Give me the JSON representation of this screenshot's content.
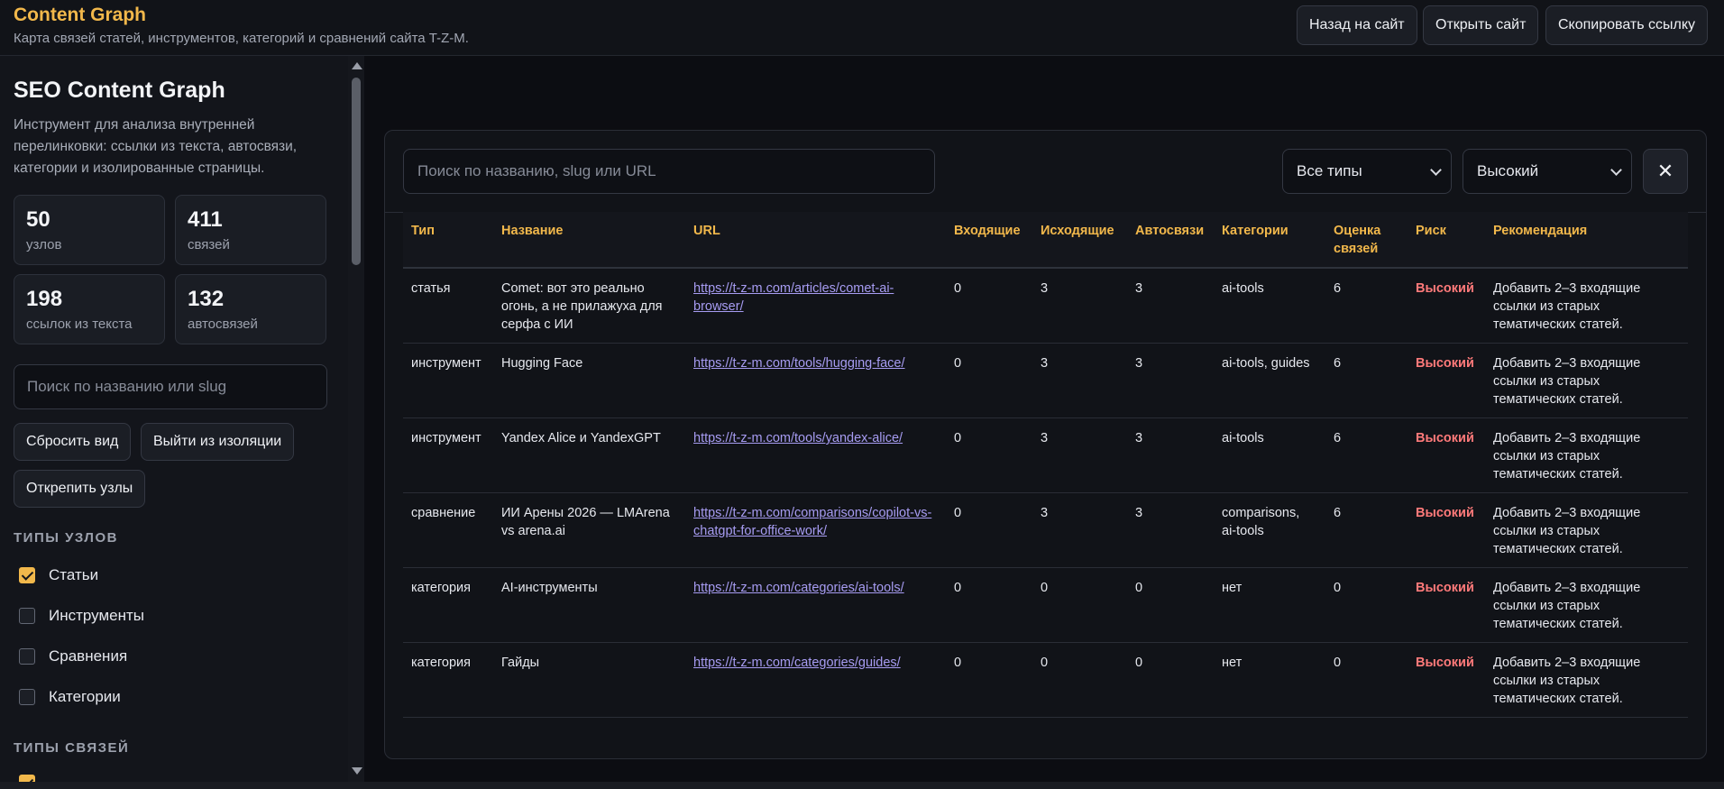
{
  "header": {
    "title": "Content Graph",
    "subtitle": "Карта связей статей, инструментов, категорий и сравнений сайта T-Z-M.",
    "buttons": {
      "back": "Назад на сайт",
      "open": "Открыть сайт",
      "copy": "Скопировать ссылку"
    }
  },
  "sidebar": {
    "title": "SEO Content Graph",
    "description": "Инструмент для анализа внутренней перелинковки: ссылки из текста, автосвязи, категории и изолированные страницы.",
    "stats": [
      {
        "value": "50",
        "label": "узлов"
      },
      {
        "value": "411",
        "label": "связей"
      },
      {
        "value": "198",
        "label": "ссылок из текста"
      },
      {
        "value": "132",
        "label": "автосвязей"
      }
    ],
    "search_placeholder": "Поиск по названию или slug",
    "buttons": {
      "reset": "Сбросить вид",
      "exit_isolation": "Выйти из изоляции",
      "unpin": "Открепить узлы"
    },
    "node_types_heading": "ТИПЫ УЗЛОВ",
    "node_types": [
      {
        "label": "Статьи",
        "checked": true
      },
      {
        "label": "Инструменты",
        "checked": false
      },
      {
        "label": "Сравнения",
        "checked": false
      },
      {
        "label": "Категории",
        "checked": false
      }
    ],
    "link_types_heading": "ТИПЫ СВЯЗЕЙ"
  },
  "filters": {
    "search_placeholder": "Поиск по названию, slug или URL",
    "type_value": "Все типы",
    "risk_value": "Высокий",
    "close_icon": "✕"
  },
  "table": {
    "headers": [
      "Тип",
      "Название",
      "URL",
      "Входящие",
      "Исходящие",
      "Автосвязи",
      "Категории",
      "Оценка связей",
      "Риск",
      "Рекомендация"
    ],
    "rows": [
      {
        "type": "статья",
        "name": "Comet: вот это реально огонь, а не прилажуха для серфа с ИИ",
        "url": "https://t-z-m.com/articles/comet-ai-browser/",
        "incoming": "0",
        "outgoing": "3",
        "auto": "3",
        "categories": "ai-tools",
        "score": "6",
        "risk": "Высокий",
        "recommendation": "Добавить 2–3 входящие ссылки из старых тематических статей."
      },
      {
        "type": "инструмент",
        "name": "Hugging Face",
        "url": "https://t-z-m.com/tools/hugging-face/",
        "incoming": "0",
        "outgoing": "3",
        "auto": "3",
        "categories": "ai-tools, guides",
        "score": "6",
        "risk": "Высокий",
        "recommendation": "Добавить 2–3 входящие ссылки из старых тематических статей."
      },
      {
        "type": "инструмент",
        "name": "Yandex Alice и YandexGPT",
        "url": "https://t-z-m.com/tools/yandex-alice/",
        "incoming": "0",
        "outgoing": "3",
        "auto": "3",
        "categories": "ai-tools",
        "score": "6",
        "risk": "Высокий",
        "recommendation": "Добавить 2–3 входящие ссылки из старых тематических статей."
      },
      {
        "type": "сравнение",
        "name": "ИИ Арены 2026 — LMArena vs arena.ai",
        "url": "https://t-z-m.com/comparisons/copilot-vs-chatgpt-for-office-work/",
        "incoming": "0",
        "outgoing": "3",
        "auto": "3",
        "categories": "comparisons, ai-tools",
        "score": "6",
        "risk": "Высокий",
        "recommendation": "Добавить 2–3 входящие ссылки из старых тематических статей."
      },
      {
        "type": "категория",
        "name": "AI-инструменты",
        "url": "https://t-z-m.com/categories/ai-tools/",
        "incoming": "0",
        "outgoing": "0",
        "auto": "0",
        "categories": "нет",
        "score": "0",
        "risk": "Высокий",
        "recommendation": "Добавить 2–3 входящие ссылки из старых тематических статей."
      },
      {
        "type": "категория",
        "name": "Гайды",
        "url": "https://t-z-m.com/categories/guides/",
        "incoming": "0",
        "outgoing": "0",
        "auto": "0",
        "categories": "нет",
        "score": "0",
        "risk": "Высокий",
        "recommendation": "Добавить 2–3 входящие ссылки из старых тематических статей."
      }
    ]
  },
  "colors": {
    "accent": "#f2b84b",
    "risk_high": "#ff7a7a",
    "link": "#a79cf2",
    "background": "#0c0d12",
    "panel": "#111318"
  }
}
